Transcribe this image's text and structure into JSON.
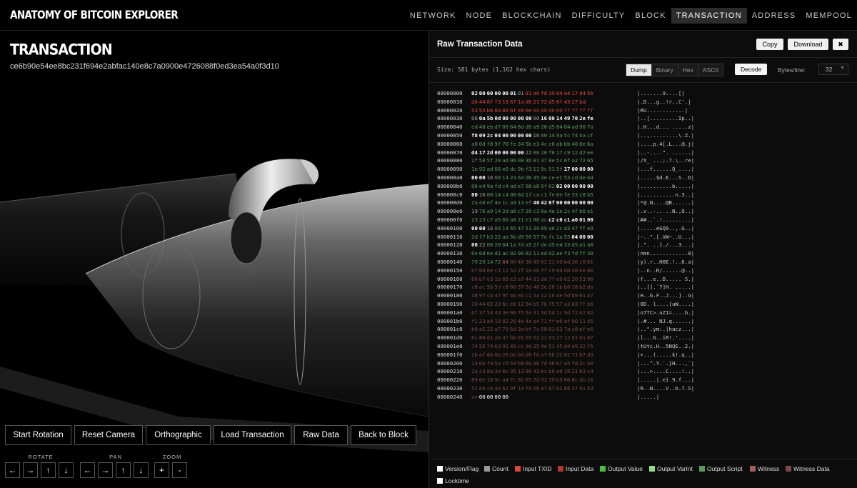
{
  "header": {
    "brand": "ANATOMY OF BITCOIN EXPLORER",
    "nav": [
      "NETWORK",
      "NODE",
      "BLOCKCHAIN",
      "DIFFICULTY",
      "BLOCK",
      "TRANSACTION",
      "ADDRESS",
      "MEMPOOL"
    ],
    "active_nav": "TRANSACTION"
  },
  "left": {
    "title": "TRANSACTION",
    "txid": "ce6b90e54ee8bc231f694e2abfac140e8c7a0900e4726088f0ed3ea54a0f3d10",
    "buttons": [
      "Start Rotation",
      "Reset Camera",
      "Orthographic",
      "Load Transaction",
      "Raw Data",
      "Back to Block"
    ],
    "controls": {
      "rotate_label": "ROTATE",
      "pan_label": "PAN",
      "zoom_label": "ZOOM",
      "arrows": [
        "←",
        "→",
        "↑",
        "↓"
      ],
      "zoom": [
        "+",
        "-"
      ]
    }
  },
  "right": {
    "title": "Raw Transaction Data",
    "copy": "Copy",
    "download": "Download",
    "close": "✖",
    "size": "Size: 581 bytes (1,162 hex chars)",
    "modes": [
      "Dump",
      "Binary",
      "Hex",
      "ASCII"
    ],
    "active_mode": "Dump",
    "decode": "Decode",
    "bytes_per_line_label": "Bytes/line:",
    "bytes_per_line": "32"
  },
  "hexdump": [
    {
      "o": "00000000",
      "b": "02 00 00 00 00 01 01 d1 a0 fd 39 84 a4 17 d4 5b",
      "a": "|.......9....[|",
      "c": "VVVVVVCTTTTTTTTT"
    },
    {
      "o": "00000010",
      "b": "d6 44 8f f3 19 67 1a d6 21 72 d5 8f 43 27 bd",
      "a": "|.D...g..!r..C'.|",
      "c": "TTTTTTTTTTTTTTT"
    },
    {
      "o": "00000020",
      "b": "52 55 b6 0a 00 bf e9 0e 00 00 00 00 ff ff ff ff",
      "a": "|RU............|",
      "c": "TTTTTTTTIIIIIIII"
    },
    {
      "o": "00000030",
      "b": "08 0a 5b 0d 00 00 00 00 00 16 00 14 49 70 2e fe",
      "a": "|..[.........Ip..|",
      "c": "CVVVVVVVCVVVVVVV"
    },
    {
      "o": "00000040",
      "b": "ed 48 eb d7 00 64 8d d0 a9 20 d5 84 04 ad 90 7a",
      "a": "|.H...d... .....z|",
      "c": "SSSSSSSSSSSSSSSS"
    },
    {
      "o": "00000050",
      "b": "f8 09 2c 04 00 00 00 00 16 00 14 9a 5c f4 5a cf",
      "a": "|..,.........\\.Z.|",
      "c": "VVVVVVVVCSSSSSSS"
    },
    {
      "o": "00000060",
      "b": "a0 0d f8 9f 70 fe 34 5b e3 4c c6 ab bb 40 8e 6a",
      "a": "|....p.4[.L...@.j|",
      "c": "SSSSSSSSSSSSSSSS"
    },
    {
      "o": "00000070",
      "b": "d4 17 2d 00 00 00 00 22 00 20 f6 17 c9 12 d2 ee",
      "a": "|..-....\". ......|",
      "c": "VVVVVVVCSSSSSSSS"
    },
    {
      "o": "00000080",
      "b": "2f 58 5f 20 ad 06 00 3b 01 37 8e 5c 0f a2 72 65",
      "a": "|/X_ ...;.7.\\..re|",
      "c": "SSSSSSSSSSSSSSSS"
    },
    {
      "o": "00000090",
      "b": "1e 92 ad 66 e0 dc 9b f3 11 9c 51 5f 17 00 00 00",
      "a": "|...f......Q_....|",
      "c": "SSSSSSSSSSSSVVVV"
    },
    {
      "o": "000000a0",
      "b": "00 00 16 00 14 24 64 d6 45 de ce e1 53 cd de 44",
      "a": "|.....$d.E...S..D|",
      "c": "VVCSSSSSSSSSSSSS"
    },
    {
      "o": "000000b0",
      "b": "06 e4 9a fd c4 ad e7 08 e8 9f 62 02 00 00 00 00",
      "a": "|..........b.....|",
      "c": "SSSSSSSSSSSVVVVV"
    },
    {
      "o": "000000c0",
      "b": "00 16 00 14 c4 00 8d 1f ca c1 fe 6e fe 33 c8 b5",
      "a": "|...........n.3..|",
      "c": "VCSSSSSSSSSSSSSS"
    },
    {
      "o": "000000d0",
      "b": "2a 40 ef 4e 1c a3 13 ef 40 42 0f 00 00 00 00 00",
      "a": "|*@.N....@B......|",
      "c": "SSSSSSSSVVVVVVVV"
    },
    {
      "o": "000000e0",
      "b": "19 76 a9 14 2d a0 c7 20 c3 0a 4e 1e 2c 4f b6 e1",
      "a": "|.v..-.. ..N.,O..|",
      "c": "CSSSSSSSSSSSSSSS"
    },
    {
      "o": "000000f0",
      "b": "23 23 c7 a5 60 a0 21 e1 88 ac c2 c0 c1 a0 01 00",
      "a": "|##..`.!.........|",
      "c": "SSSSSSSSSSVVVVVV"
    },
    {
      "o": "00000100",
      "b": "00 00 16 00 14 65 47 51 39 89 a6 2c d3 47 ff e9",
      "a": "|.....eGQ9..,.G..|",
      "c": "VVCSSSSSSSSSSSSS"
    },
    {
      "o": "00000110",
      "b": "2d f7 b3 22 aa 5b d9 56 57 7e fc 1a 55 04 00 00",
      "a": "|-..\".[.VW~..U...|",
      "c": "SSSSSSSSSSSSSVVV"
    },
    {
      "o": "00000120",
      "b": "00 22 00 20 04 1a 7d a5 2f de d5 e4 33 d5 a1 a0",
      "a": "|.\". ..}./...3...|",
      "c": "VCSSSSSSSSSSSSSS"
    },
    {
      "o": "00000130",
      "b": "6e 6d 6e d1 ac 02 90 82 11 ed 02 ae f3 fd ff 38",
      "a": "|nmn............8|",
      "c": "SSSSSSSSSSSSSSSS"
    },
    {
      "o": "00000140",
      "b": "79 29 14 72 04 00 48 30 45 02 21 00 bd 36 c0 61",
      "a": "|y).r..H0E.!..6.a|",
      "c": "SSSSWDDDDDDDDDDD"
    },
    {
      "o": "00000150",
      "b": "bf 0d 6e c1 11 52 2f 10 eb ff c9 8d dd 40 ee 80",
      "a": "|..n..R/......@..|",
      "c": "DDDDDDDDDDDDDDDD"
    },
    {
      "o": "00000160",
      "b": "66 b7 e3 1b 65 e3 a7 44 d1 dd 7f e9 02 20 53 90",
      "a": "|f...e..D..... S.|",
      "c": "DDDDDDDDDDDDDDDD"
    },
    {
      "o": "00000170",
      "b": "c8 ac 5b 5d c8 60 37 5d 48 2e 20 1b b0 18 b2 da",
      "a": "|..[].`7]H. .....|",
      "c": "DDDDDDDDDDDDDDDD"
    },
    {
      "o": "00000180",
      "b": "48 97 cb 47 9f 46 eb c1 4a 12 c6 de 5d b9 01 47",
      "a": "|H..G.F..J...]..G|",
      "c": "DDDDDDDDDDDDDDDD"
    },
    {
      "o": "00000190",
      "b": "30 44 02 20 6c e0 12 94 b5 7b 75 57 a3 03 7f b6",
      "a": "|0D. l....{uW....|",
      "c": "DDDDDDDDDDDDDDDD"
    },
    {
      "o": "000001a0",
      "b": "6f 37 54 43 3e 96 75 5a 31 3d bd 1c 9d f2 62 82",
      "a": "|o7TC>.uZ1=....b.|",
      "c": "DDDDDDDDDDDDDDDD"
    },
    {
      "o": "000001b0",
      "b": "f1 23 a4 10 02 20 4e 4a a4 71 ff e0 af 00 11 05",
      "a": "|.#... NJ.q......|",
      "c": "DDDDDDDDDDDDDDDD"
    },
    {
      "o": "000001c0",
      "b": "b0 a5 22 a7 79 6d 3a bf 7c 68 61 63 7a c8 ef e6",
      "a": "|..\".ym:.|hacz...|",
      "c": "DDDDDDDDDDDDDDDD"
    },
    {
      "o": "000001d0",
      "b": "6c 88 d1 a6 47 bb 01 69 52 21 03 27 12 81 01 87",
      "a": "|l...G..iR!.'....|",
      "c": "DDDDDDDDDDDDDDDD"
    },
    {
      "o": "000001e0",
      "b": "74 55 74 63 91 48 cc 9d 35 4e 51 45 d4 e9 32 f5",
      "a": "|tUtc.H..5NQE..2.|",
      "c": "DDDDDDDDDDDDDDDD"
    },
    {
      "o": "000001f0",
      "b": "2b af 8b 0b 28 bb 0d d0 f0 a7 6b 21 02 71 87 d3",
      "a": "|+...(.....k!.q..|",
      "c": "DDDDDDDDDDDDDDDD"
    },
    {
      "o": "00000200",
      "b": "14 0b fa 5e c9 59 b8 60 a6 7d 48 b7 a5 fd 2c 60",
      "a": "|...^.Y.`.}H...,`|",
      "c": "DDDDDDDDDDDDDDDD"
    },
    {
      "o": "00000210",
      "b": "1a c3 8a 3e bc 95 13 88 43 ec b0 ad 19 21 03 c4",
      "a": "|...>....C....!..|",
      "c": "DDDDDDDDDDDDDDDD"
    },
    {
      "o": "00000220",
      "b": "89 0e 10 9c a4 7c 8b 65 7d 92 39 b5 66 8c db 10",
      "a": "|.....|.e}.9.f...|",
      "c": "DDDDDDDDDDDDDDDD"
    },
    {
      "o": "00000230",
      "b": "52 e9 ce 4e b2 9f 14 fd 56 a7 87 62 88 37 01 53",
      "a": "|R..N....V..b.7.S|",
      "c": "DDDDDDDDDDDDDDDD"
    },
    {
      "o": "00000240",
      "b": "ae 00 00 00 00",
      "a": "|.....|",
      "c": "DLLLL"
    }
  ],
  "legend": [
    {
      "label": "Version/Flag",
      "color": "#ffffff"
    },
    {
      "label": "Count",
      "color": "#9a9a9a"
    },
    {
      "label": "Input TXID",
      "color": "#e0453a"
    },
    {
      "label": "Input Data",
      "color": "#b03a30"
    },
    {
      "label": "Output Value",
      "color": "#45c045"
    },
    {
      "label": "Output VarInt",
      "color": "#8fdc8f"
    },
    {
      "label": "Output Script",
      "color": "#5c9a5c"
    },
    {
      "label": "Witness",
      "color": "#a36058"
    },
    {
      "label": "Witness Data",
      "color": "#7a4a45"
    },
    {
      "label": "Locktime",
      "color": "#ffffff"
    }
  ]
}
